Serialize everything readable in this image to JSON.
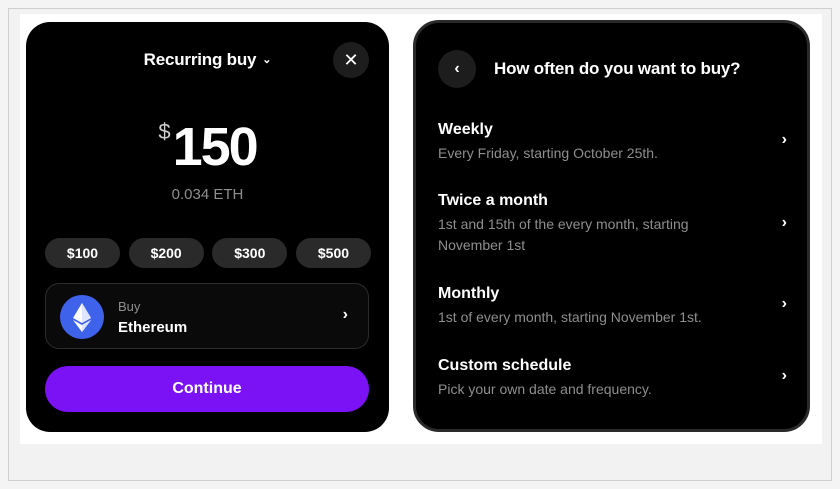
{
  "left_card": {
    "header_title": "Recurring buy",
    "header_chevron": "⌄",
    "close_icon": "✕",
    "currency_symbol": "$",
    "amount": "150",
    "eth_equivalent": "0.034 ETH",
    "presets": [
      "$100",
      "$200",
      "$300",
      "$500"
    ],
    "asset": {
      "label": "Buy",
      "name": "Ethereum",
      "icon": "ethereum-icon",
      "chevron": "›"
    },
    "continue_label": "Continue"
  },
  "right_card": {
    "back_icon": "‹",
    "title": "How often do you want to buy?",
    "options": [
      {
        "title": "Weekly",
        "description": "Every Friday, starting October 25th.",
        "chevron": "›"
      },
      {
        "title": "Twice a month",
        "description": "1st and 15th of the every month, starting November 1st",
        "chevron": "›"
      },
      {
        "title": "Monthly",
        "description": "1st of every month, starting November 1st.",
        "chevron": "›"
      },
      {
        "title": "Custom schedule",
        "description": "Pick your own date and frequency.",
        "chevron": "›"
      }
    ]
  },
  "colors": {
    "accent_purple": "#7b12f6",
    "ethereum_blue": "#3f62ea",
    "card_background": "#000000",
    "muted_text": "#8e8e8e"
  }
}
